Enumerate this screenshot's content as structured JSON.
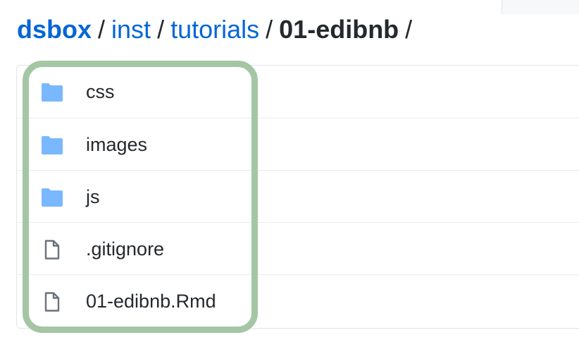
{
  "breadcrumb": {
    "root": "dsbox",
    "parts": [
      "inst",
      "tutorials"
    ],
    "current": "01-edibnb",
    "separator": "/"
  },
  "files": [
    {
      "name": "css",
      "type": "folder",
      "icon": "folder-icon"
    },
    {
      "name": "images",
      "type": "folder",
      "icon": "folder-icon"
    },
    {
      "name": "js",
      "type": "folder",
      "icon": "folder-icon"
    },
    {
      "name": ".gitignore",
      "type": "file",
      "icon": "file-icon"
    },
    {
      "name": "01-edibnb.Rmd",
      "type": "file",
      "icon": "file-icon"
    }
  ],
  "colors": {
    "folder": "#79b8ff",
    "file_stroke": "#6a737d",
    "link": "#0366d6",
    "highlight": "#a4c6a4"
  }
}
